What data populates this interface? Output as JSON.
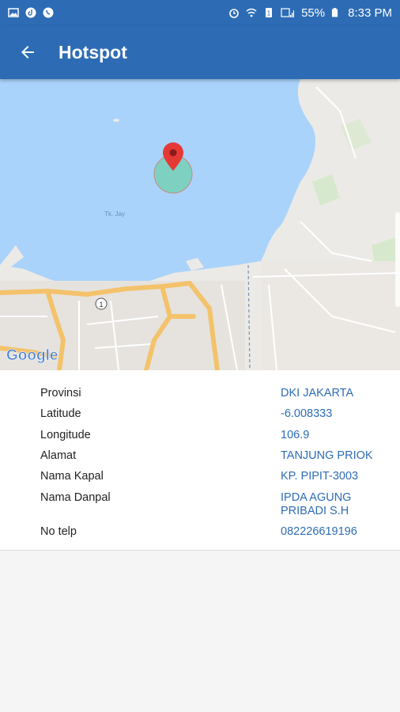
{
  "status_bar": {
    "battery_percent": "55%",
    "time": "8:33 PM",
    "left_icons": [
      "image-icon",
      "tiktok-icon",
      "whatsapp-icon"
    ],
    "right_icons": [
      "alarm-icon",
      "wifi-icon",
      "sim-icon",
      "signal-icon",
      "battery-icon"
    ]
  },
  "app_bar": {
    "title": "Hotspot",
    "back_icon": "arrow-back-icon"
  },
  "map": {
    "provider_logo": "Google",
    "area_label": "Tk. Jay",
    "road_shield": "1",
    "marker_icon": "map-pin-icon",
    "water_color": "#aad3fb",
    "land_color": "#eceae6",
    "hotspot_circle_color": "#7ed0c1",
    "marker_color": "#e53935"
  },
  "details": [
    {
      "label": "Provinsi",
      "value": "DKI JAKARTA"
    },
    {
      "label": "Latitude",
      "value": "-6.008333"
    },
    {
      "label": "Longitude",
      "value": "106.9"
    },
    {
      "label": "Alamat",
      "value": "TANJUNG PRIOK"
    },
    {
      "label": "Nama Kapal",
      "value": "KP. PIPIT-3003"
    },
    {
      "label": "Nama Danpal",
      "value": "IPDA AGUNG PRIBADI S.H"
    },
    {
      "label": "No telp",
      "value": "082226619196"
    }
  ],
  "colors": {
    "primary": "#2d6cb5",
    "value_text": "#2d6cb5"
  }
}
